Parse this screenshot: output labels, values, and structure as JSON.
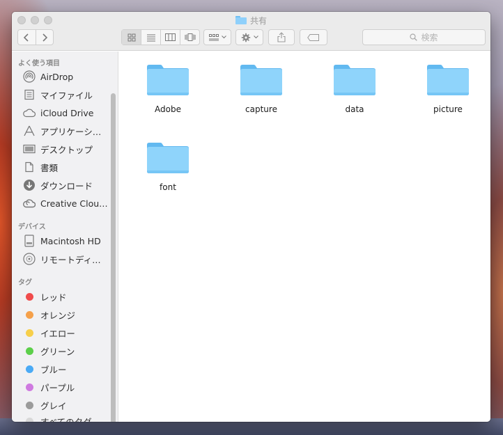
{
  "window": {
    "title": "共有"
  },
  "toolbar": {
    "back_icon": "chevron-left-icon",
    "forward_icon": "chevron-right-icon",
    "view_modes": [
      "icon-view-icon",
      "list-view-icon",
      "column-view-icon",
      "coverflow-view-icon"
    ],
    "search_placeholder": "検索"
  },
  "sidebar": {
    "favorites_header": "よく使う項目",
    "favorites": [
      {
        "label": "AirDrop",
        "icon": "airdrop-icon"
      },
      {
        "label": "マイファイル",
        "icon": "all-my-files-icon"
      },
      {
        "label": "iCloud Drive",
        "icon": "cloud-icon"
      },
      {
        "label": "アプリケーシ…",
        "icon": "applications-icon"
      },
      {
        "label": "デスクトップ",
        "icon": "desktop-icon"
      },
      {
        "label": "書類",
        "icon": "documents-icon"
      },
      {
        "label": "ダウンロード",
        "icon": "downloads-icon"
      },
      {
        "label": "Creative Clou…",
        "icon": "creative-cloud-icon"
      }
    ],
    "devices_header": "デバイス",
    "devices": [
      {
        "label": "Macintosh HD",
        "icon": "hard-drive-icon"
      },
      {
        "label": "リモートディ…",
        "icon": "remote-disc-icon"
      }
    ],
    "tags_header": "タグ",
    "tags": [
      {
        "label": "レッド",
        "color": "#f04b4b"
      },
      {
        "label": "オレンジ",
        "color": "#f5a04a"
      },
      {
        "label": "イエロー",
        "color": "#f7cf4a"
      },
      {
        "label": "グリーン",
        "color": "#5ccf4a"
      },
      {
        "label": "ブルー",
        "color": "#4aaaf5"
      },
      {
        "label": "パープル",
        "color": "#cf7ae0"
      },
      {
        "label": "グレイ",
        "color": "#9b9b9b"
      },
      {
        "label": "すべてのタグ…",
        "color": "#d8d8d8"
      }
    ]
  },
  "content": {
    "folders": [
      "Adobe",
      "capture",
      "data",
      "picture",
      "font"
    ]
  },
  "colors": {
    "folder_light": "#8fd4fb",
    "folder_dark": "#62b9f0"
  }
}
